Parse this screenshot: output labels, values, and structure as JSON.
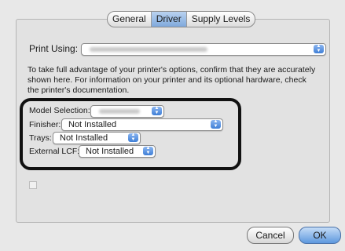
{
  "tabs": [
    {
      "label": "General",
      "active": false
    },
    {
      "label": "Driver",
      "active": true
    },
    {
      "label": "Supply Levels",
      "active": false
    }
  ],
  "print_using": {
    "label": "Print Using:",
    "value": ""
  },
  "description": "To take full advantage of your printer's options, confirm that they are accurately shown here. For information on your printer and its optional hardware, check the printer's documentation.",
  "options": {
    "model_selection": {
      "label": "Model Selection:",
      "value": ""
    },
    "finisher": {
      "label": "Finisher:",
      "value": "Not Installed"
    },
    "trays": {
      "label": "Trays:",
      "value": "Not Installed"
    },
    "external_lcf": {
      "label": "External LCF:",
      "value": "Not Installed"
    }
  },
  "buttons": {
    "cancel": "Cancel",
    "ok": "OK"
  },
  "colors": {
    "accent": "#5d98de",
    "highlight_border": "#111111"
  },
  "icons": {
    "popup_arrows": "up-down-arrows-icon"
  }
}
